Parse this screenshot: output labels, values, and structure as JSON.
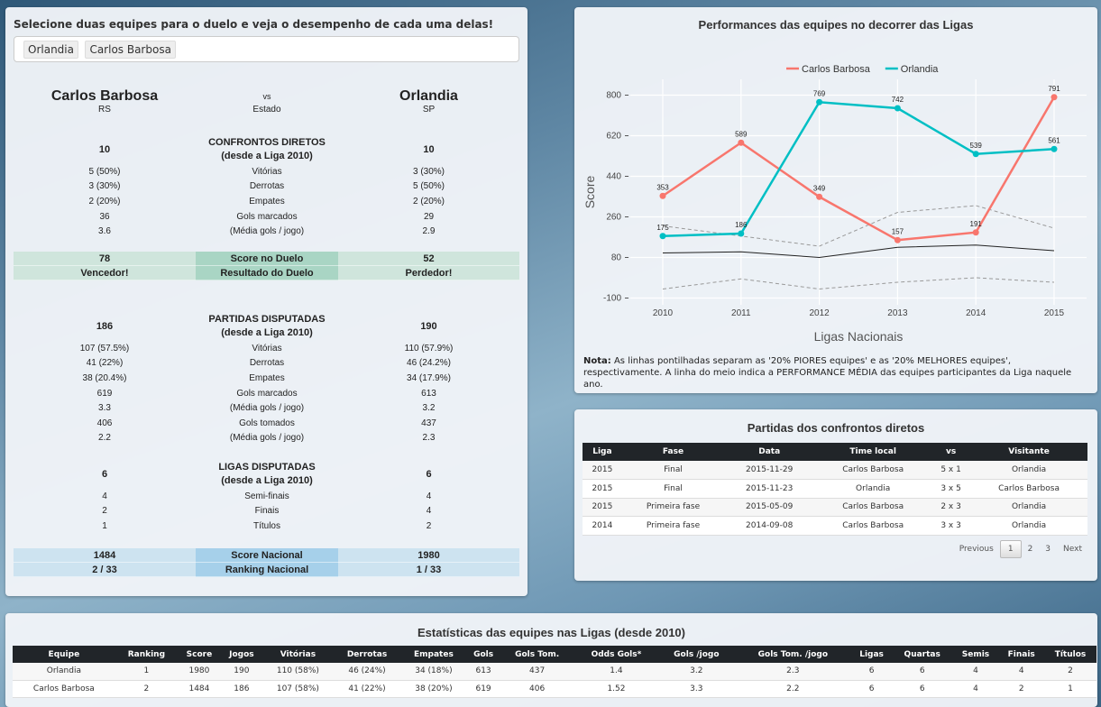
{
  "duel": {
    "prompt": "Selecione duas equipes para o duelo e veja o desempenho de cada uma delas!",
    "selected": [
      "Orlandia",
      "Carlos Barbosa"
    ],
    "left_team": "Carlos Barbosa",
    "left_state": "RS",
    "vs": "vs",
    "state_label": "Estado",
    "right_team": "Orlandia",
    "right_state": "SP",
    "h2h": {
      "title1": "CONFRONTOS DIRETOS",
      "title2": "(desde a Liga 2010)",
      "left_total": "10",
      "right_total": "10",
      "rows": [
        {
          "left": "5 (50%)",
          "label": "Vitórias",
          "right": "3 (30%)"
        },
        {
          "left": "3 (30%)",
          "label": "Derrotas",
          "right": "5 (50%)"
        },
        {
          "left": "2 (20%)",
          "label": "Empates",
          "right": "2 (20%)"
        },
        {
          "left": "36",
          "label": "Gols marcados",
          "right": "29"
        },
        {
          "left": "3.6",
          "label": "(Média gols / jogo)",
          "right": "2.9"
        }
      ]
    },
    "score_row": {
      "left": "78",
      "label": "Score no Duelo",
      "right": "52"
    },
    "result_row": {
      "left": "Vencedor!",
      "label": "Resultado do Duelo",
      "right": "Perdedor!"
    },
    "matches": {
      "title1": "PARTIDAS DISPUTADAS",
      "title2": "(desde a Liga 2010)",
      "left_total": "186",
      "right_total": "190",
      "rows": [
        {
          "left": "107 (57.5%)",
          "label": "Vitórias",
          "right": "110 (57.9%)"
        },
        {
          "left": "41 (22%)",
          "label": "Derrotas",
          "right": "46 (24.2%)"
        },
        {
          "left": "38 (20.4%)",
          "label": "Empates",
          "right": "34 (17.9%)"
        },
        {
          "left": "619",
          "label": "Gols marcados",
          "right": "613"
        },
        {
          "left": "3.3",
          "label": "(Média gols / jogo)",
          "right": "3.2"
        },
        {
          "left": "406",
          "label": "Gols tomados",
          "right": "437"
        },
        {
          "left": "2.2",
          "label": "(Média gols / jogo)",
          "right": "2.3"
        }
      ]
    },
    "leagues": {
      "title1": "LIGAS DISPUTADAS",
      "title2": "(desde a Liga 2010)",
      "left_total": "6",
      "right_total": "6",
      "rows": [
        {
          "left": "4",
          "label": "Semi-finais",
          "right": "4"
        },
        {
          "left": "2",
          "label": "Finais",
          "right": "4"
        },
        {
          "left": "1",
          "label": "Títulos",
          "right": "2"
        }
      ]
    },
    "national_score": {
      "left": "1484",
      "label": "Score Nacional",
      "right": "1980"
    },
    "national_rank": {
      "left": "2 / 33",
      "label": "Ranking Nacional",
      "right": "1 / 33"
    }
  },
  "perf": {
    "title": "Performances das equipes no decorrer das Ligas",
    "note_bold": "Nota:",
    "note_text": " As linhas pontilhadas separam as '20% PIORES equipes' e as '20% MELHORES equipes', respectivamente. A linha do meio indica a PERFORMANCE MÉDIA das equipes participantes da Liga naquele ano."
  },
  "chart_data": {
    "type": "line",
    "xlabel": "Ligas Nacionais",
    "ylabel": "Score",
    "x": [
      2010,
      2011,
      2012,
      2013,
      2014,
      2015
    ],
    "ylim": [
      -130,
      870
    ],
    "yticks": [
      -100,
      80,
      260,
      440,
      620,
      800
    ],
    "legend_position": "top",
    "grid": true,
    "series": [
      {
        "name": "Carlos Barbosa",
        "color": "#f8766d",
        "values": [
          353,
          589,
          349,
          157,
          191,
          791
        ]
      },
      {
        "name": "Orlandia",
        "color": "#00bfc4",
        "values": [
          175,
          186,
          769,
          742,
          539,
          561
        ]
      }
    ],
    "reference_lines": [
      {
        "style": "dashed",
        "color": "#999999",
        "values": [
          220,
          175,
          130,
          280,
          310,
          210
        ]
      },
      {
        "style": "solid",
        "color": "#222222",
        "values": [
          100,
          105,
          80,
          125,
          135,
          110
        ]
      },
      {
        "style": "dashed",
        "color": "#999999",
        "values": [
          -60,
          -15,
          -60,
          -30,
          -10,
          -30
        ]
      }
    ]
  },
  "h2h_matches": {
    "title": "Partidas dos confrontos diretos",
    "columns": [
      "Liga",
      "Fase",
      "Data",
      "Time local",
      "vs",
      "Visitante"
    ],
    "rows": [
      [
        "2015",
        "Final",
        "2015-11-29",
        "Carlos Barbosa",
        "5 x 1",
        "Orlandia"
      ],
      [
        "2015",
        "Final",
        "2015-11-23",
        "Orlandia",
        "3 x 5",
        "Carlos Barbosa"
      ],
      [
        "2015",
        "Primeira fase",
        "2015-05-09",
        "Carlos Barbosa",
        "2 x 3",
        "Orlandia"
      ],
      [
        "2014",
        "Primeira fase",
        "2014-09-08",
        "Carlos Barbosa",
        "3 x 3",
        "Orlandia"
      ]
    ],
    "pager": {
      "previous": "Previous",
      "pages": [
        "1",
        "2",
        "3"
      ],
      "next": "Next"
    }
  },
  "league_stats": {
    "title": "Estatísticas das equipes nas Ligas (desde 2010)",
    "columns": [
      "Equipe",
      "Ranking",
      "Score",
      "Jogos",
      "Vitórias",
      "Derrotas",
      "Empates",
      "Gols",
      "Gols Tom.",
      "Odds Gols*",
      "Gols /jogo",
      "Gols Tom. /jogo",
      "Ligas",
      "Quartas",
      "Semis",
      "Finais",
      "Títulos"
    ],
    "rows": [
      [
        "Orlandia",
        "1",
        "1980",
        "190",
        "110 (58%)",
        "46 (24%)",
        "34 (18%)",
        "613",
        "437",
        "1.4",
        "3.2",
        "2.3",
        "6",
        "6",
        "4",
        "4",
        "2"
      ],
      [
        "Carlos Barbosa",
        "2",
        "1484",
        "186",
        "107 (58%)",
        "41 (22%)",
        "38 (20%)",
        "619",
        "406",
        "1.52",
        "3.3",
        "2.2",
        "6",
        "6",
        "4",
        "2",
        "1"
      ]
    ]
  }
}
